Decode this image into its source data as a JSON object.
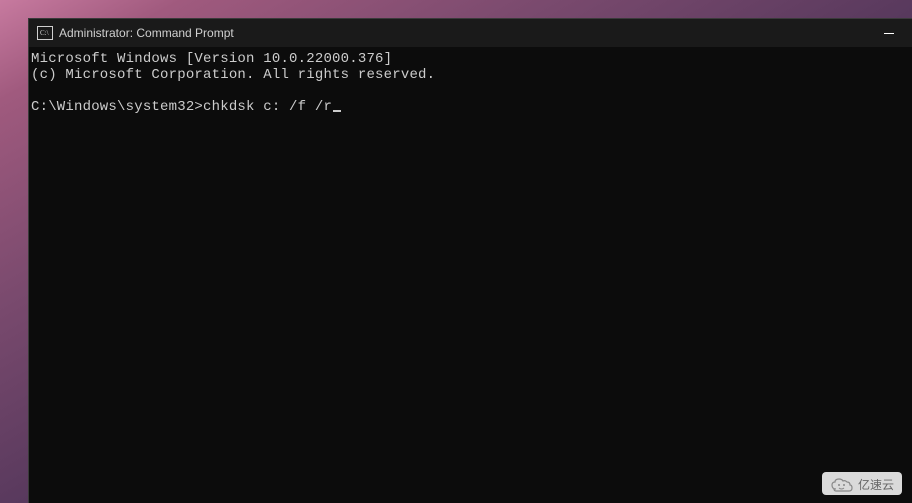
{
  "titlebar": {
    "title": "Administrator: Command Prompt"
  },
  "terminal": {
    "line1": "Microsoft Windows [Version 10.0.22000.376]",
    "line2": "(c) Microsoft Corporation. All rights reserved.",
    "prompt": "C:\\Windows\\system32>",
    "command": "chkdsk c: /f /r"
  },
  "watermark": {
    "text": "亿速云"
  }
}
